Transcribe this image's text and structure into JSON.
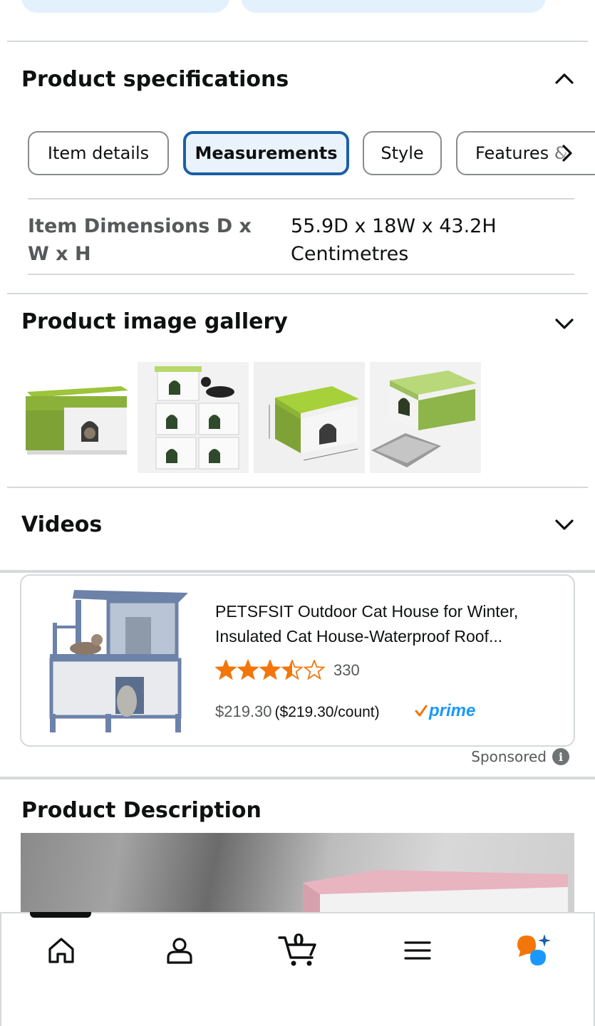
{
  "colors": {
    "accent_blue": "#1a5fa8",
    "star_orange": "#f3760a",
    "prime_blue": "#1a98ff",
    "rufus_orange": "#f3760a",
    "rufus_blue": "#1a98ff"
  },
  "specifications": {
    "title": "Product specifications",
    "chevron_icon": "chevron-up-icon",
    "tabs": [
      {
        "label": "Item details",
        "active": false
      },
      {
        "label": "Measurements",
        "active": true
      },
      {
        "label": "Style",
        "active": false
      },
      {
        "label": "Features &",
        "active": false
      }
    ],
    "scroll_icon": "chevron-right-icon",
    "rows": [
      {
        "label": "Item Dimensions D x W x H",
        "value": "55.9D x 18W x 43.2H Centimetres"
      }
    ]
  },
  "gallery": {
    "title": "Product image gallery",
    "chevron_icon": "chevron-down-icon",
    "thumbnails": [
      "cat-house-green-thumbnail",
      "stacked-cat-houses-thumbnail",
      "cat-house-dimensions-thumbnail",
      "cat-house-with-mat-thumbnail"
    ]
  },
  "videos": {
    "title": "Videos",
    "chevron_icon": "chevron-down-icon"
  },
  "sponsored_ad": {
    "title": "PETSFSIT Outdoor Cat House for Winter, Insulated Cat House-Waterproof Roof...",
    "rating": 3.5,
    "review_count": "330",
    "price": "$219.30",
    "unit_price": "($219.30/count)",
    "prime_label": "prime",
    "sponsored_label": "Sponsored",
    "info_icon": "i"
  },
  "description": {
    "title": "Product Description"
  },
  "bottom_nav": {
    "items": [
      "home-icon",
      "account-icon",
      "cart-icon",
      "menu-icon",
      "rufus-icon"
    ],
    "cart_count": "0"
  }
}
